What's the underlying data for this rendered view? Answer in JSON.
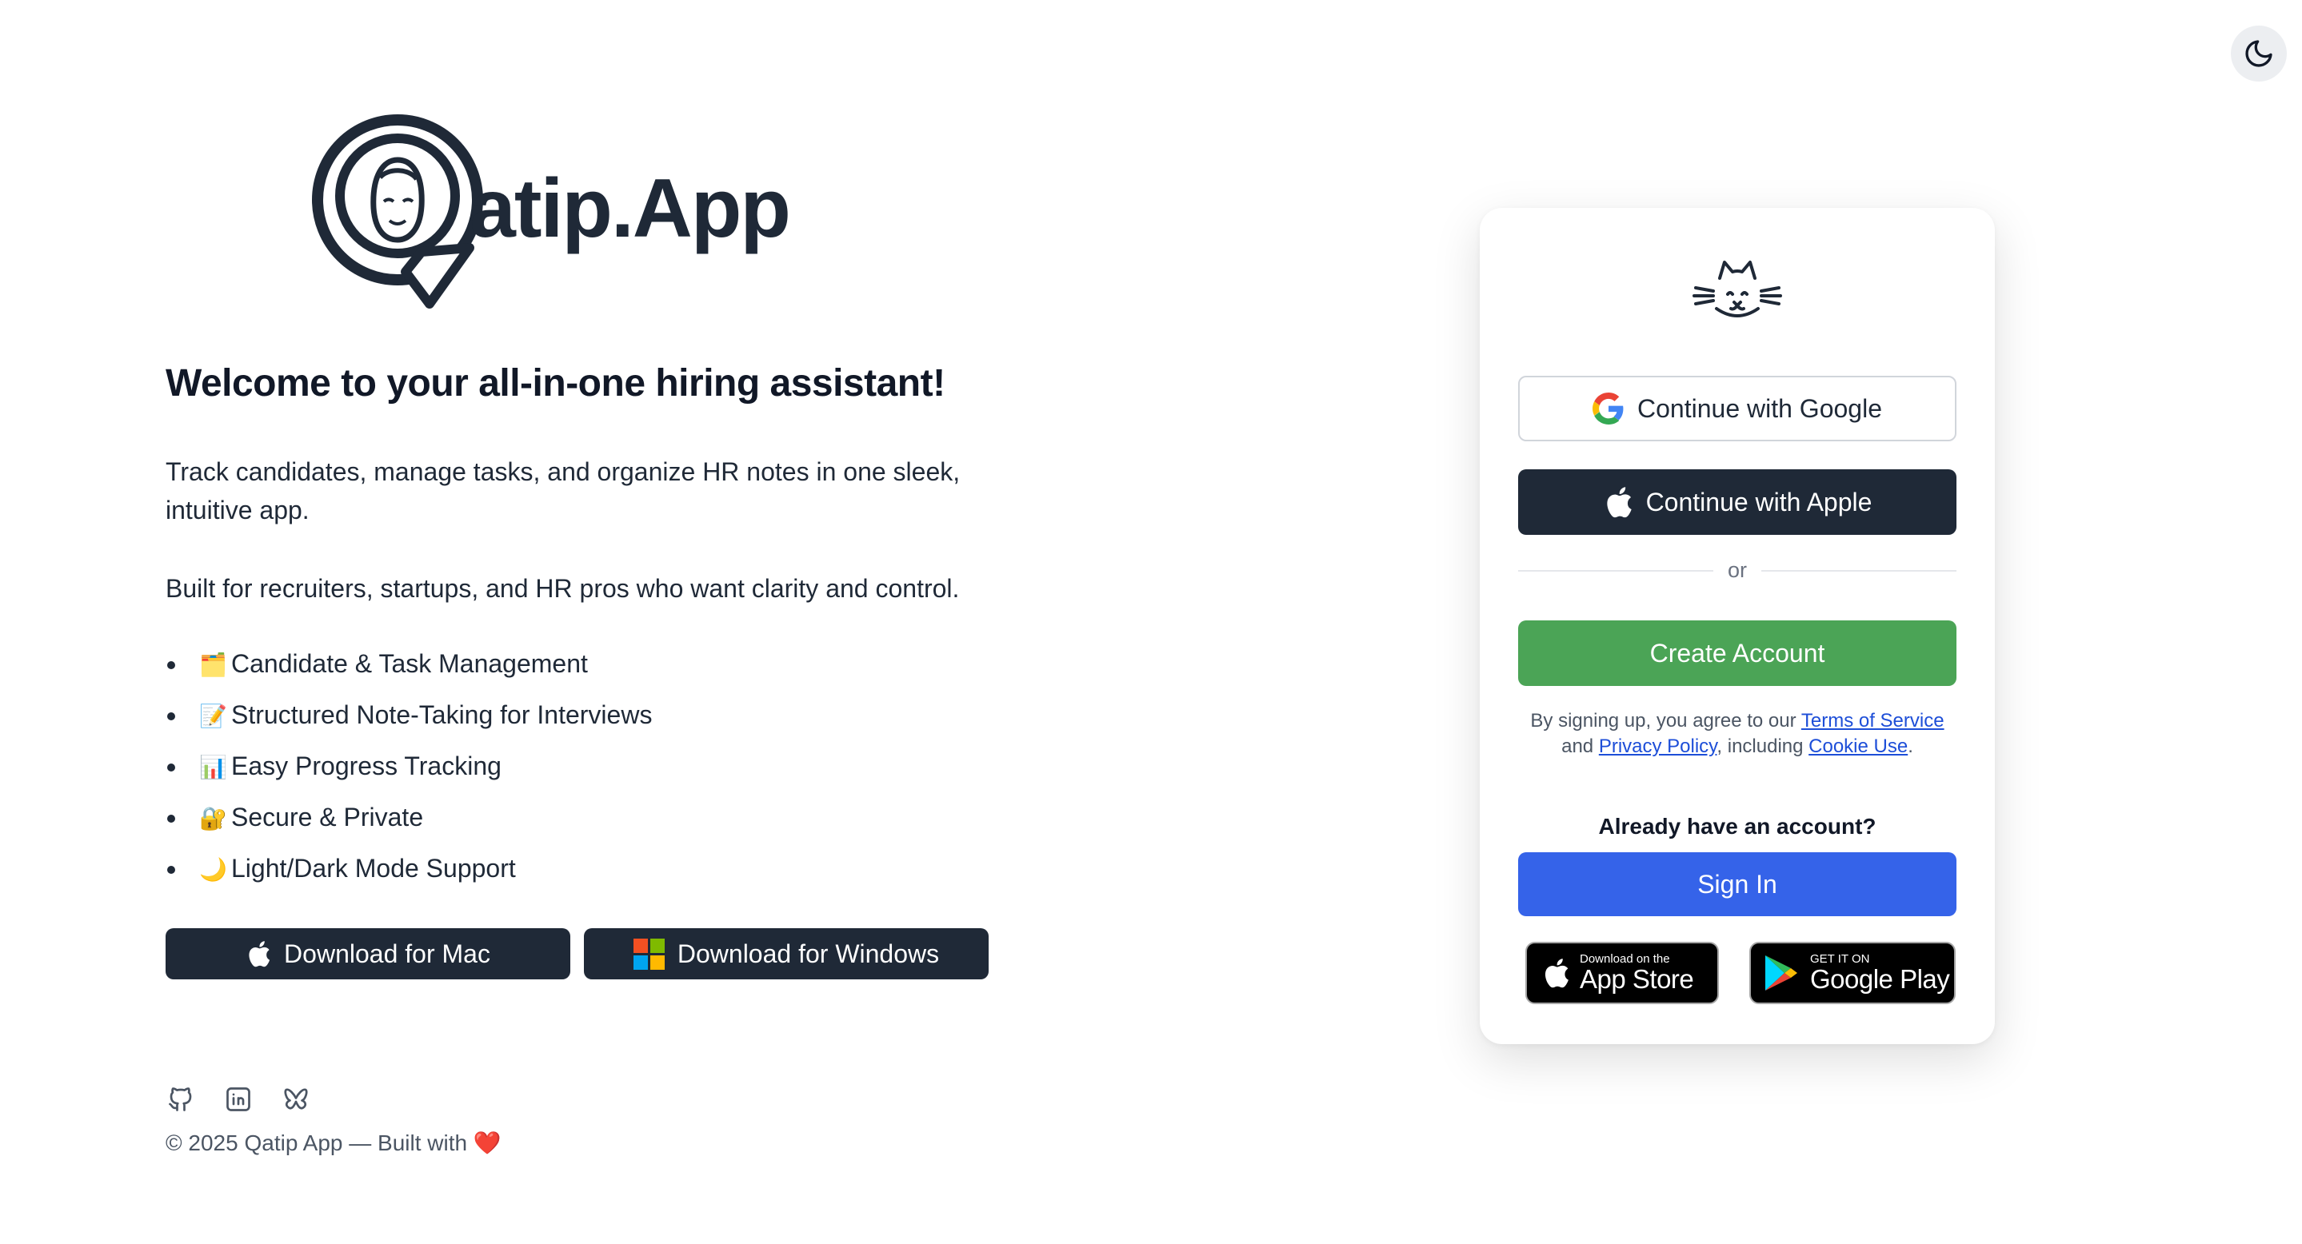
{
  "theme_toggle": {
    "icon": "moon-icon"
  },
  "brand": {
    "logo_text": "atip.App",
    "logo_icon": "qatip-q-logo-icon"
  },
  "hero": {
    "welcome": "Welcome to your all-in-one hiring assistant!",
    "para1": "Track candidates, manage tasks, and organize HR notes in one sleek, intuitive app.",
    "para2": "Built for recruiters, startups, and HR pros who want clarity and control."
  },
  "features": [
    {
      "emoji": "🗂️",
      "label": "Candidate & Task Management"
    },
    {
      "emoji": "📝",
      "label": "Structured Note-Taking for Interviews"
    },
    {
      "emoji": "📊",
      "label": "Easy Progress Tracking"
    },
    {
      "emoji": "🔐",
      "label": "Secure & Private"
    },
    {
      "emoji": "🌙",
      "label": "Light/Dark Mode Support"
    }
  ],
  "downloads": {
    "mac": "Download for Mac",
    "windows": "Download for Windows"
  },
  "socials": [
    "github-icon",
    "linkedin-icon",
    "bluesky-icon"
  ],
  "footer": {
    "text": "© 2025 Qatip App — Built with",
    "heart": "❤️"
  },
  "auth": {
    "cat_icon": "cat-face-icon",
    "google": "Continue with Google",
    "apple": "Continue with Apple",
    "or": "or",
    "create": "Create Account",
    "terms_prefix": "By signing up, you agree to our",
    "terms_link": "Terms of Service",
    "and": "and",
    "privacy_link": "Privacy Policy",
    "including": ", including",
    "cookie_link": "Cookie Use",
    "period": ".",
    "already": "Already have an account?",
    "signin": "Sign In",
    "appstore_small": "Download on the",
    "appstore_big": "App Store",
    "gplay_small": "GET IT ON",
    "gplay_big": "Google Play"
  },
  "colors": {
    "primary_dark": "#1f2937",
    "create_green": "#4ba456",
    "signin_blue": "#3563e9",
    "link_blue": "#1d4ed8"
  }
}
